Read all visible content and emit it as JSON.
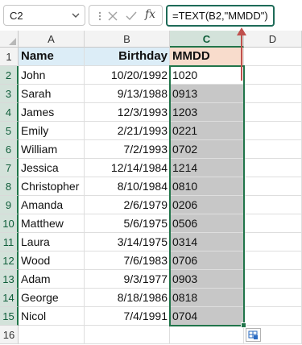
{
  "name_box": {
    "value": "C2"
  },
  "formula_bar": {
    "cancel_icon": "x-icon",
    "enter_icon": "checkmark-icon",
    "function_label": "fx",
    "formula": "=TEXT(B2,\"MMDD\")"
  },
  "columns": [
    "A",
    "B",
    "C",
    "D"
  ],
  "row_numbers": [
    "1",
    "2",
    "3",
    "4",
    "5",
    "6",
    "7",
    "8",
    "9",
    "10",
    "11",
    "12",
    "13",
    "14",
    "15",
    "16"
  ],
  "headers": {
    "name": "Name",
    "birthday": "Birthday",
    "mmdd": "MMDD"
  },
  "rows": [
    {
      "name": "John",
      "birthday": "10/20/1992",
      "mmdd": "1020"
    },
    {
      "name": "Sarah",
      "birthday": "9/13/1988",
      "mmdd": "0913"
    },
    {
      "name": "James",
      "birthday": "12/3/1993",
      "mmdd": "1203"
    },
    {
      "name": "Emily",
      "birthday": "2/21/1993",
      "mmdd": "0221"
    },
    {
      "name": "William",
      "birthday": "7/2/1993",
      "mmdd": "0702"
    },
    {
      "name": "Jessica",
      "birthday": "12/14/1984",
      "mmdd": "1214"
    },
    {
      "name": "Christopher",
      "birthday": "8/10/1984",
      "mmdd": "0810"
    },
    {
      "name": "Amanda",
      "birthday": "2/6/1979",
      "mmdd": "0206"
    },
    {
      "name": "Matthew",
      "birthday": "5/6/1975",
      "mmdd": "0506"
    },
    {
      "name": "Laura",
      "birthday": "3/14/1975",
      "mmdd": "0314"
    },
    {
      "name": "Wood",
      "birthday": "7/6/1983",
      "mmdd": "0706"
    },
    {
      "name": "Adam",
      "birthday": "9/3/1977",
      "mmdd": "0903"
    },
    {
      "name": "George",
      "birthday": "8/18/1986",
      "mmdd": "0818"
    },
    {
      "name": "Nicol",
      "birthday": "7/4/1991",
      "mmdd": "0704"
    }
  ],
  "colors": {
    "selection": "#21754a",
    "header_blue": "#dcedf7",
    "header_orange": "#f8dccc",
    "filled_cells": "#c7c7c7",
    "annotation_arrow": "#c0504d"
  }
}
